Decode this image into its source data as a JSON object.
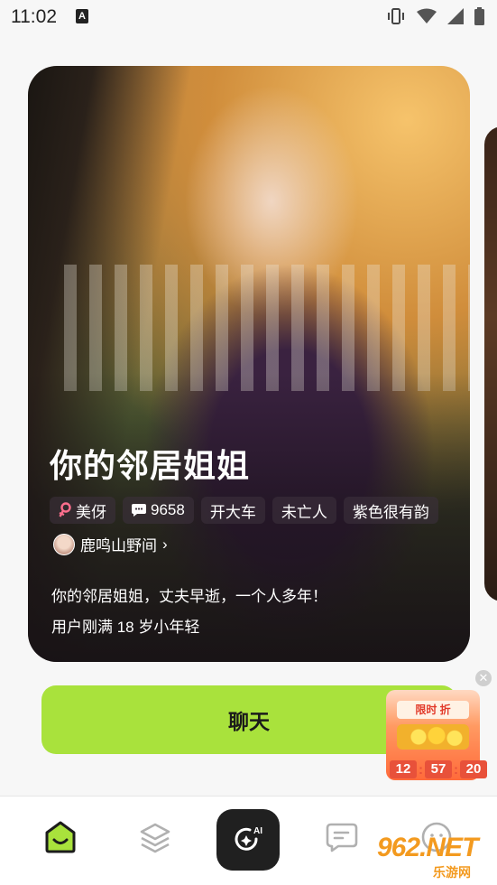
{
  "status_bar": {
    "time": "11:02",
    "notification_icon": "A"
  },
  "card": {
    "title": "你的邻居姐姐",
    "tags": [
      {
        "icon": "female-icon",
        "label": "美伢"
      },
      {
        "icon": "chat-count-icon",
        "label": "9658"
      },
      {
        "icon": "",
        "label": "开大车"
      },
      {
        "icon": "",
        "label": "未亡人"
      },
      {
        "icon": "",
        "label": "紫色很有韵"
      }
    ],
    "creator": "鹿鸣山野间",
    "description": "你的邻居姐姐，丈夫早逝，一个人多年！",
    "age_note": "用户刚满 18 岁小年轻"
  },
  "chat_button": "聊天",
  "promo": {
    "banner": "限时  折",
    "timer": [
      "12",
      "57",
      "20"
    ]
  },
  "bottom_nav": {
    "ai_badge": "AI"
  },
  "watermark": {
    "logo": "962.NET",
    "sub": "乐游网"
  },
  "colors": {
    "accent_green": "#a9e23c",
    "promo_red": "#e8513a",
    "dress_purple": "#3a2240"
  }
}
